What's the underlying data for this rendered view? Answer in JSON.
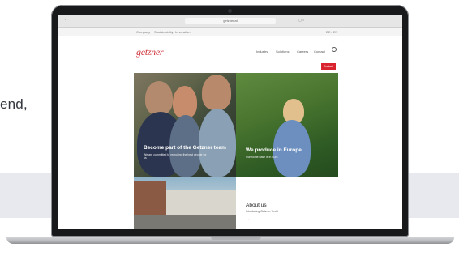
{
  "background": {
    "text_fragment": "end,"
  },
  "browser": {
    "url": "getzner.at",
    "back_icon": "chevron-left-icon",
    "tabs_icon": "tabs-icon"
  },
  "site": {
    "topbar": {
      "left_items": [
        "Company",
        "Sustainability",
        "Innovation"
      ],
      "right_text": "DE / EN"
    },
    "logo": "getzner",
    "nav": [
      "Industry",
      "Solutions",
      "Careers",
      "Contact"
    ],
    "cta_label": "Contact",
    "tiles": [
      {
        "title": "Become part of the Getzner team",
        "subtitle": "We are committed to recruiting the best people for us"
      },
      {
        "title": "We produce in Europe",
        "subtitle": "Our home base is in Bürs"
      },
      {
        "title": "",
        "subtitle": ""
      },
      {
        "title": "About us",
        "subtitle": "Introducing Getzner Textil",
        "arrow": "→"
      }
    ]
  },
  "colors": {
    "brand_red": "#d9232e",
    "band": "#e8e9ee"
  }
}
